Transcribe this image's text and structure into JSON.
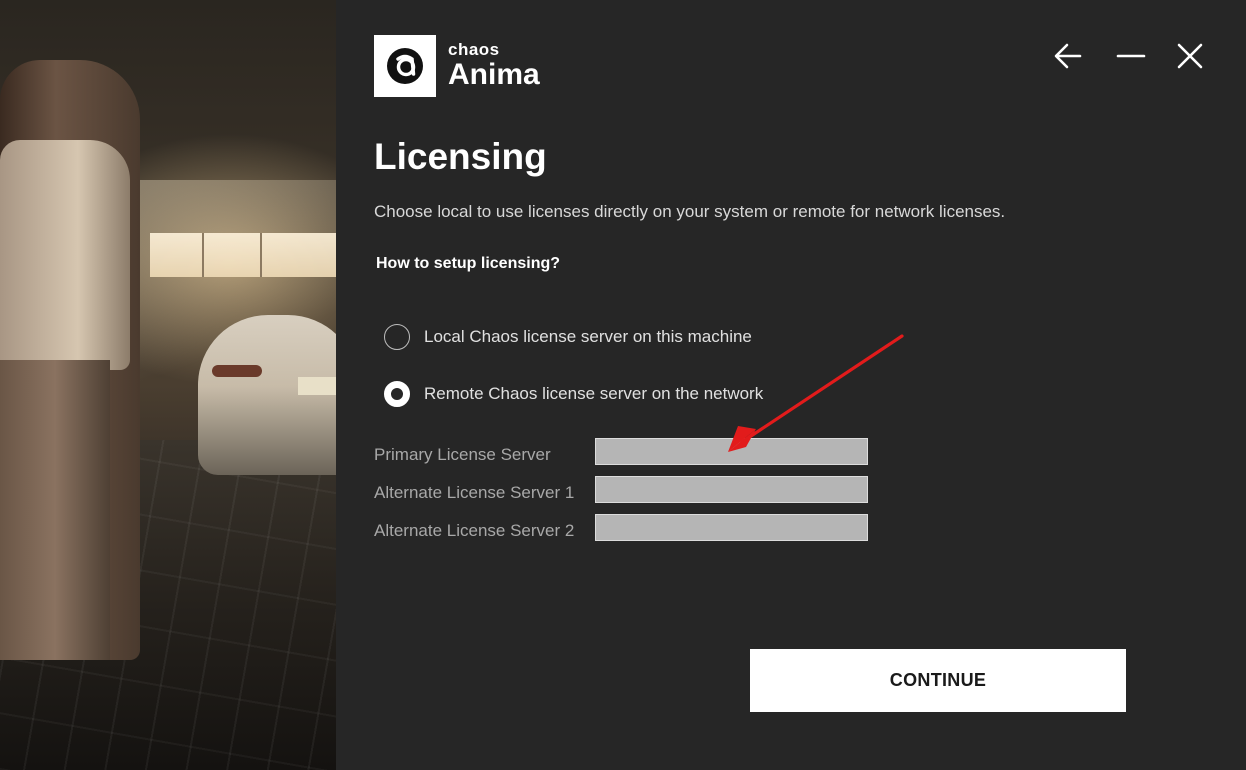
{
  "brand": {
    "top": "chaos",
    "main": "Anima"
  },
  "window": {
    "back_icon": "arrow-left-icon",
    "minimize_icon": "minus-icon",
    "close_icon": "close-icon"
  },
  "page": {
    "title": "Licensing",
    "subtitle": "Choose local to use licenses directly on your system or remote for network licenses.",
    "question": "How to setup licensing?"
  },
  "options": [
    {
      "label": "Local Chaos license server on this machine",
      "selected": false
    },
    {
      "label": "Remote Chaos license server on the network",
      "selected": true
    }
  ],
  "fields": [
    {
      "label": "Primary License Server",
      "value": ""
    },
    {
      "label": "Alternate License Server 1",
      "value": ""
    },
    {
      "label": "Alternate License Server 2",
      "value": ""
    }
  ],
  "actions": {
    "continue_label": "CONTINUE"
  },
  "colors": {
    "background": "#262626",
    "annotation_arrow": "#e21b1b",
    "input_fill": "#b5b5b5"
  }
}
